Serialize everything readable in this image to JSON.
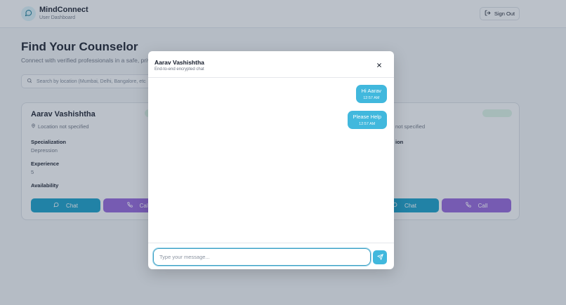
{
  "header": {
    "brand": "MindConnect",
    "subtitle": "User Dashboard",
    "sign_out": "Sign Out"
  },
  "main": {
    "title": "Find Your Counselor",
    "subtitle": "Connect with verified professionals in a safe, priva",
    "search_placeholder": "Search by location (Mumbai, Delhi, Bangalore, etc"
  },
  "cards": [
    {
      "name": "Aarav Vashishtha",
      "location": "Location not specified",
      "specialization_label": "Specialization",
      "specialization": "Depression",
      "experience_label": "Experience",
      "experience": "5",
      "availability_label": "Availability",
      "chat_label": "Chat",
      "call_label": "Call"
    },
    {
      "location": "not specified",
      "specialization_label": "ion",
      "chat_label": "Chat",
      "call_label": "Call"
    }
  ],
  "chat_modal": {
    "title": "Aarav Vashishtha",
    "subtitle": "End-to-end encrypted chat",
    "messages": [
      {
        "text": "Hi Aarav",
        "time": "12:57 AM"
      },
      {
        "text": "Please Help",
        "time": "12:57 AM"
      }
    ],
    "input_placeholder": "Type your message..."
  },
  "colors": {
    "chat_button": "#0e99c5",
    "call_button": "#8f5ed8",
    "bubble": "#41b8dd",
    "send_button": "#41b8dd"
  }
}
